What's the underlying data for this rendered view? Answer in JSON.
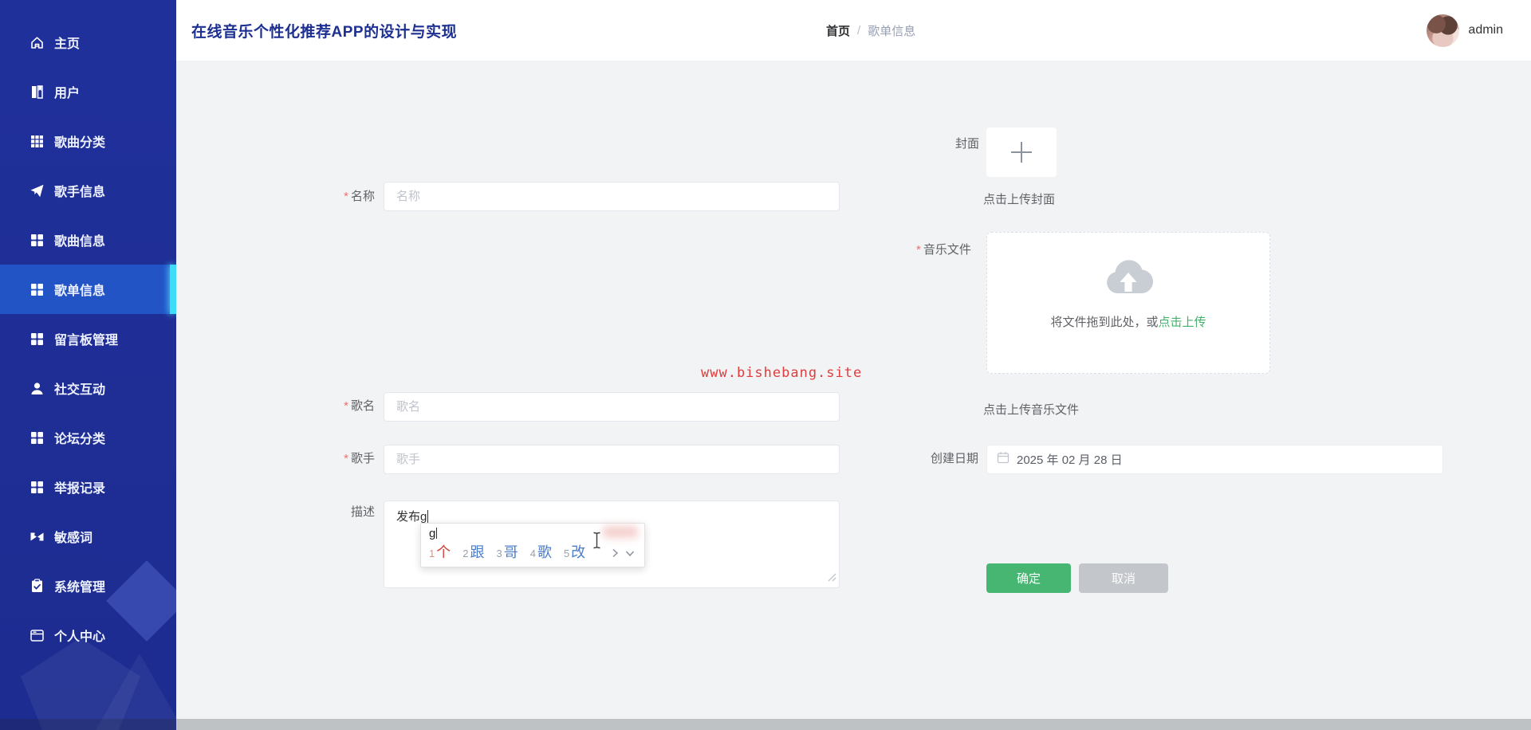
{
  "app": {
    "title": "在线音乐个性化推荐APP的设计与实现"
  },
  "header": {
    "breadcrumb": {
      "home": "首页",
      "separator": "/",
      "current": "歌单信息"
    },
    "user": "admin"
  },
  "sidebar": {
    "items": [
      {
        "label": "主页",
        "icon": "home-icon",
        "active": false
      },
      {
        "label": "用户",
        "icon": "book-icon",
        "active": false
      },
      {
        "label": "歌曲分类",
        "icon": "grid9-icon",
        "active": false
      },
      {
        "label": "歌手信息",
        "icon": "send-icon",
        "active": false
      },
      {
        "label": "歌曲信息",
        "icon": "grid4-icon",
        "active": false
      },
      {
        "label": "歌单信息",
        "icon": "grid4-icon",
        "active": true
      },
      {
        "label": "留言板管理",
        "icon": "grid4-icon",
        "active": false
      },
      {
        "label": "社交互动",
        "icon": "user-icon",
        "active": false
      },
      {
        "label": "论坛分类",
        "icon": "grid4-icon",
        "active": false
      },
      {
        "label": "举报记录",
        "icon": "grid4-icon",
        "active": false
      },
      {
        "label": "敏感词",
        "icon": "bowtie-icon",
        "active": false
      },
      {
        "label": "系统管理",
        "icon": "clipboard-icon",
        "active": false
      },
      {
        "label": "个人中心",
        "icon": "card-icon",
        "active": false
      }
    ]
  },
  "form": {
    "required_mark": "*",
    "name": {
      "label": "名称",
      "placeholder": "名称"
    },
    "song": {
      "label": "歌名",
      "placeholder": "歌名"
    },
    "singer": {
      "label": "歌手",
      "placeholder": "歌手"
    },
    "desc": {
      "label": "描述",
      "value": "发布g"
    },
    "cover": {
      "label": "封面",
      "hint": "点击上传封面"
    },
    "music": {
      "label": "音乐文件",
      "drop_text": "将文件拖到此处，或",
      "drop_link": "点击上传",
      "hint": "点击上传音乐文件"
    },
    "date": {
      "label": "创建日期",
      "value": "2025 年 02 月 28 日"
    },
    "buttons": {
      "confirm": "确定",
      "cancel": "取消"
    }
  },
  "watermark": "www.bishebang.site",
  "ime": {
    "composition": "g",
    "candidates": [
      {
        "num": "1",
        "text": "个"
      },
      {
        "num": "2",
        "text": "跟"
      },
      {
        "num": "3",
        "text": "哥"
      },
      {
        "num": "4",
        "text": "歌"
      },
      {
        "num": "5",
        "text": "改"
      }
    ]
  },
  "colors": {
    "sidebar_blue": "#1f2e96",
    "active_blue": "#2254c6",
    "accent_cyan": "#3ddcf7",
    "accent_green": "#46b672",
    "watermark_red": "#e03c3c",
    "title_blue": "#1d3091"
  }
}
